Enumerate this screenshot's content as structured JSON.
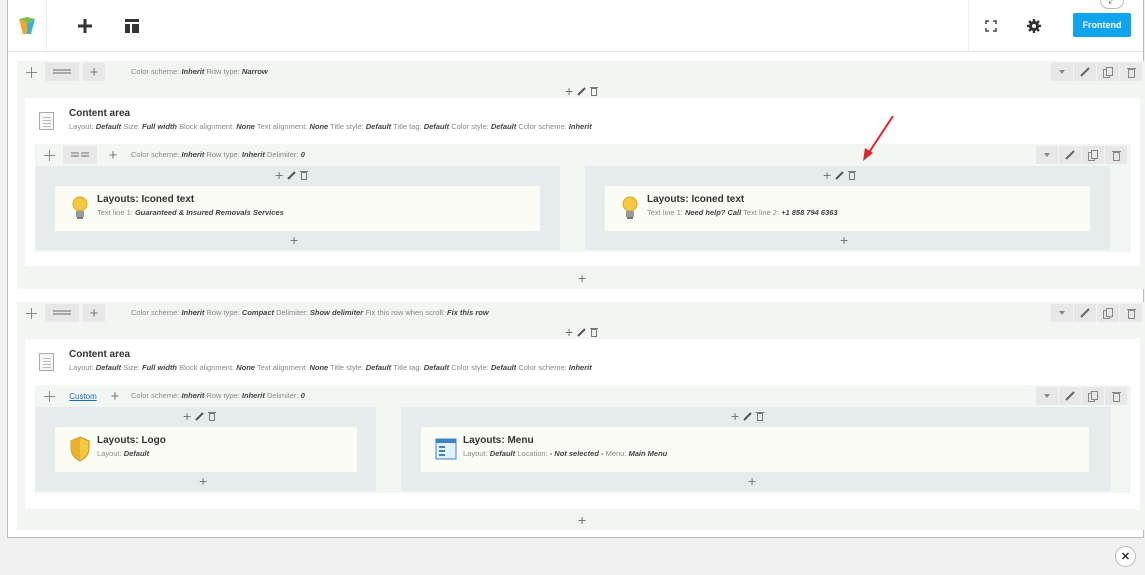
{
  "toolbar": {
    "frontend_label": "Frontend",
    "corner_icon": "expand-icon"
  },
  "rows": [
    {
      "color_scheme_label": "Color scheme:",
      "color_scheme": "Inherit",
      "row_type_label": "Row type:",
      "row_type": "Narrow",
      "content": {
        "title": "Content area",
        "layout": "Default",
        "size": "Full width",
        "block_alignment": "None",
        "text_alignment": "None",
        "title_style": "Default",
        "title_tag": "Default",
        "color_style": "Default",
        "color_scheme": "Inherit"
      },
      "inner": {
        "color_scheme": "Inherit",
        "row_type": "Inherit",
        "delimiter": "0"
      },
      "elements": [
        {
          "title": "Layouts: Iconed text",
          "info": "Text line 1: ",
          "v1": "Guaranteed & Insured Removals Services",
          "l2": "",
          "v2": ""
        },
        {
          "title": "Layouts: Iconed text",
          "info": "Text line 1: ",
          "v1": "Need help? Call",
          "l2": " Text line 2: ",
          "v2": "+1 858 794 6363"
        }
      ]
    },
    {
      "color_scheme_label": "Color scheme:",
      "color_scheme": "Inherit",
      "row_type_label": "Row type:",
      "row_type": "Compact",
      "delimiter_label": "Delimiter:",
      "delimiter": "Show delimiter",
      "fix_label": "Fix this row when scroll:",
      "fix": "Fix this row",
      "content": {
        "title": "Content area",
        "layout": "Default",
        "size": "Full width",
        "block_alignment": "None",
        "text_alignment": "None",
        "title_style": "Default",
        "title_tag": "Default",
        "color_style": "Default",
        "color_scheme": "Inherit"
      },
      "inner": {
        "custom_label": "Custom",
        "color_scheme": "Inherit",
        "row_type": "Inherit",
        "delimiter": "0"
      },
      "elements": [
        {
          "title": "Layouts: Logo",
          "info": "Layout: ",
          "v1": "Default"
        },
        {
          "title": "Layouts: Menu",
          "info": "Layout: ",
          "v1": "Default",
          "l2": " Location: ",
          "v2": "- Not selected -",
          "l3": " Menu: ",
          "v3": "Main Menu"
        }
      ]
    }
  ],
  "labels": {
    "layout": "Layout:",
    "size": "Size:",
    "block_alignment": "Block alignment:",
    "text_alignment": "Text alignment:",
    "title_style": "Title style:",
    "title_tag": "Title tag:",
    "color_style": "Color style:",
    "color_scheme": "Color scheme:",
    "row_type": "Row type:",
    "delimiter": "Delimiter:"
  },
  "colors": {
    "accent": "#0fa4f0",
    "annotation": "#e3242b"
  }
}
